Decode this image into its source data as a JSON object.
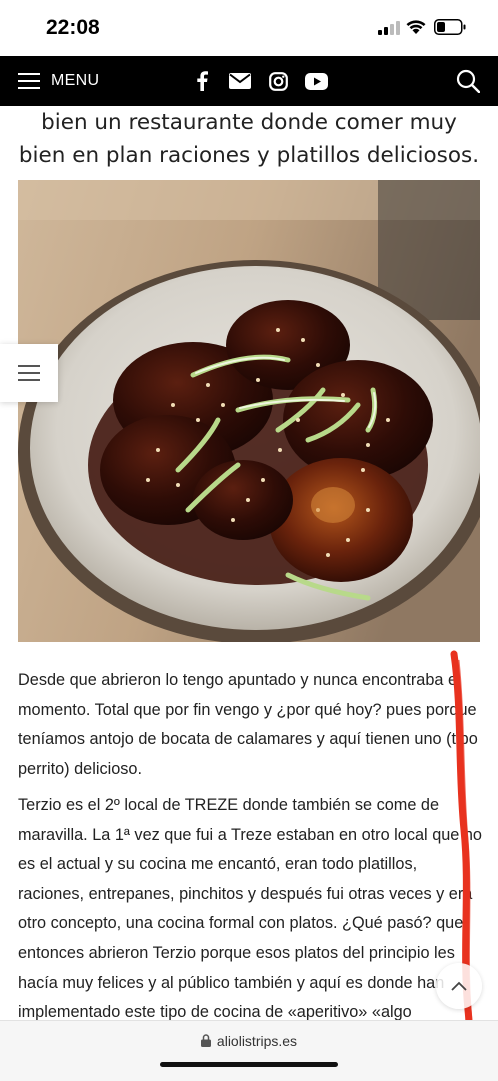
{
  "status_bar": {
    "time": "22:08"
  },
  "nav": {
    "menu_label": "MENU",
    "social_icons": [
      "facebook-icon",
      "mail-icon",
      "instagram-icon",
      "youtube-icon"
    ]
  },
  "article": {
    "heading_lines": [
      "bien un restaurante donde comer muy",
      "bien en plan raciones y platillos deliciosos."
    ],
    "paragraph1": "Desde que abrieron lo tengo apuntado y nunca encontraba el momento. Total que por fin vengo y ¿por qué hoy? pues porque teníamos antojo de bocata de calamares y aquí tienen uno (tipo perrito) delicioso.",
    "paragraph2": "Terzio es el 2º local de TREZE donde también se come de maravilla. La 1ª vez que fui a Treze estaban en otro local que no es el actual y su cocina me encantó, eran todo platillos, raciones, entrepanes, pinchitos y después fui otras veces y era otro concepto, una cocina formal con platos. ¿Qué pasó? que entonces abrieron Terzio porque esos platos del principio les hacía muy felices y al público también y aquí es donde han implementado este tipo de cocina de «aperitivo» «algo informal» etc.; se dieron cuenta de que estos platillos"
  },
  "browser": {
    "url": "aliolistrips.es"
  },
  "colors": {
    "nav_bg": "#000000",
    "red_mark": "#e8321f"
  }
}
